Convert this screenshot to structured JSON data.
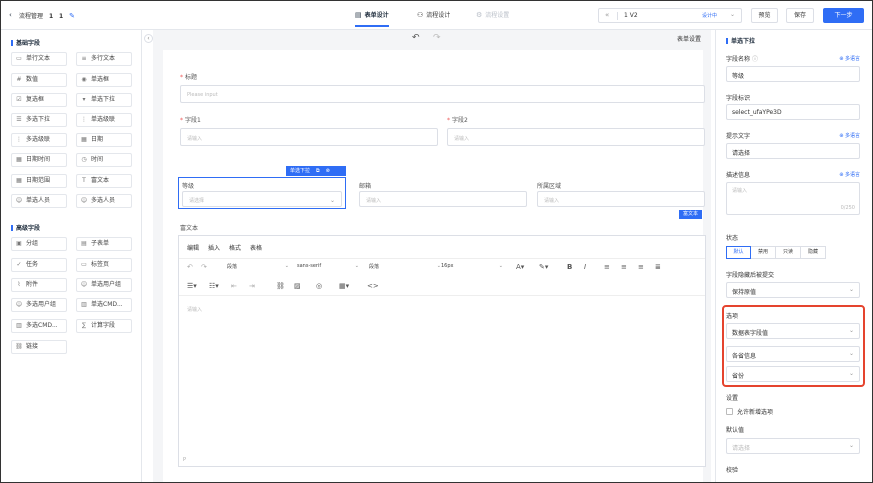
{
  "header": {
    "back_icon": "chevron-left-icon",
    "breadcrumb": "流程管理",
    "version_a": "1",
    "version_b": "1",
    "tabs": [
      {
        "label": "表单设计",
        "icon": "form-icon",
        "state": "active"
      },
      {
        "label": "流程设计",
        "icon": "flow-icon",
        "state": "normal"
      },
      {
        "label": "流程设置",
        "icon": "settings-icon",
        "state": "disabled"
      }
    ],
    "version_select": {
      "value": "1 V2",
      "badge": "设计中"
    },
    "buttons": {
      "preview": "预览",
      "save": "保存",
      "next": "下一步"
    }
  },
  "palette": {
    "basic_title": "基础字段",
    "basic_items": [
      "单行文本",
      "多行文本",
      "数值",
      "单选框",
      "复选框",
      "单选下拉",
      "多选下拉",
      "单选级联",
      "多选级联",
      "日期",
      "日期时间",
      "时间",
      "日期范围",
      "富文本",
      "单选人员",
      "多选人员"
    ],
    "advanced_title": "高级字段",
    "advanced_items": [
      "分组",
      "子表单",
      "任务",
      "标签页",
      "附件",
      "单选用户组",
      "多选用户组",
      "单选CMD...",
      "多选CMD...",
      "计算字段",
      "链接"
    ]
  },
  "canvas": {
    "form_settings": "表单设置",
    "fields": {
      "title_label": "标题",
      "title_placeholder": "Please input",
      "field1_label": "字段1",
      "field1_placeholder": "请输入",
      "field2_label": "字段2",
      "field2_placeholder": "请输入",
      "priority_label": "等级",
      "priority_placeholder": "请选择",
      "email_label": "邮箱",
      "email_placeholder": "请输入",
      "region_label": "所属区域",
      "region_placeholder": "请输入"
    },
    "selected_tag": "单选下拉",
    "rich_tag": "富文本",
    "rich_label": "富文本",
    "rich_menu": [
      "编辑",
      "插入",
      "格式",
      "表格"
    ],
    "rich_toolbar": {
      "block": "段落",
      "font": "sans-serif",
      "align": "段落",
      "size": "16px"
    },
    "rich_placeholder": "请输入",
    "rich_footer": "P"
  },
  "panel": {
    "title": "单选下拉",
    "field_name_label": "字段名称",
    "field_name_value": "等级",
    "multilang_link": "多语言",
    "field_id_label": "字段标识",
    "field_id_value": "select_ufaYPe3D",
    "hint_label": "提示文字",
    "hint_value": "请选择",
    "desc_label": "描述信息",
    "desc_placeholder": "请输入",
    "desc_count": "0/250",
    "state_label": "状态",
    "state_options": [
      "默认",
      "禁用",
      "只读",
      "隐藏"
    ],
    "state_selected": "默认",
    "hidden_label": "字段隐藏后被提交",
    "hidden_value": "保持原值",
    "options_label": "选项",
    "options_source": "数据表字段值",
    "options_table": "各省信息",
    "options_field": "省份",
    "settings_label": "设置",
    "allow_new_label": "允许新增选项",
    "default_label": "默认值",
    "default_placeholder": "请选择",
    "validate_label": "校验"
  },
  "colors": {
    "primary": "#2f6df5",
    "highlight": "#e5442e",
    "canvas_bg": "#f4f5f7"
  }
}
